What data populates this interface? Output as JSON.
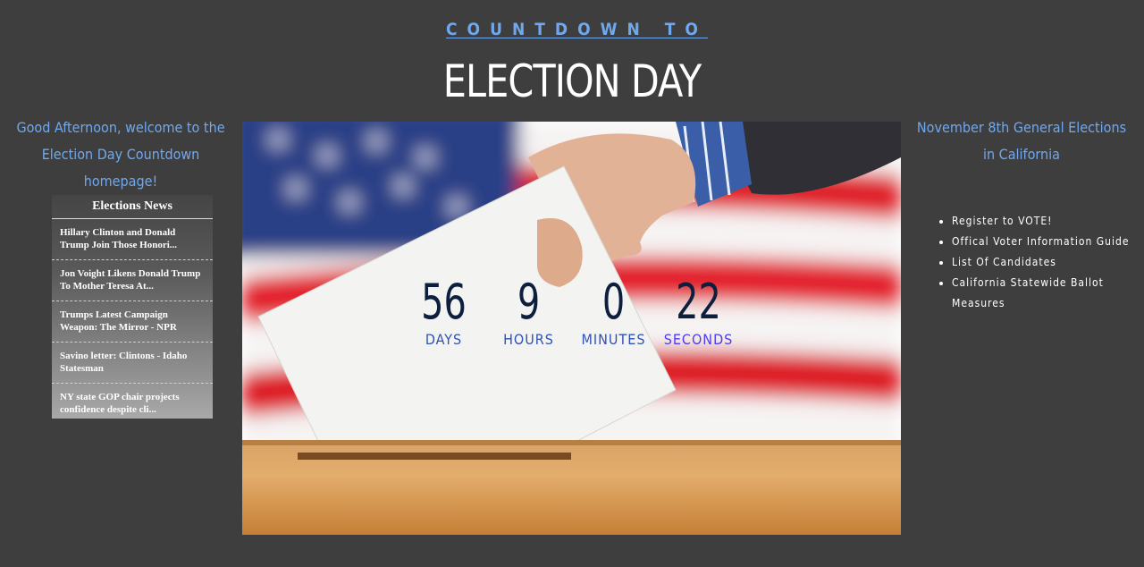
{
  "header": {
    "kicker": "COUNTDOWN TO",
    "title": "ELECTION DAY"
  },
  "greeting": "Good Afternoon, welcome to the Election Day Countdown homepage!",
  "news": {
    "title": "Elections News",
    "items": [
      "Hillary Clinton and Donald Trump Join Those Honori...",
      "Jon Voight Likens Donald Trump To Mother Teresa At...",
      "Trumps Latest Campaign Weapon: The Mirror - NPR",
      "Savino letter: Clintons - Idaho Statesman",
      "NY state GOP chair projects confidence despite cli..."
    ]
  },
  "countdown": {
    "days": "56",
    "days_label": "DAYS",
    "hours": "9",
    "hours_label": "HOURS",
    "minutes": "0",
    "minutes_label": "MINUTES",
    "seconds": "22",
    "seconds_label": "SECONDS"
  },
  "sidebar": {
    "heading": "November 8th General Elections in California",
    "links": [
      "Register to VOTE!",
      "Offical Voter Information Guide",
      "List Of Candidates",
      "California Statewide Ballot Measures"
    ]
  },
  "colors": {
    "background": "#3e3e3e",
    "accent": "#6fa8ef",
    "countdown_number": "#0c1f3d",
    "countdown_label": "#2d52b5"
  }
}
